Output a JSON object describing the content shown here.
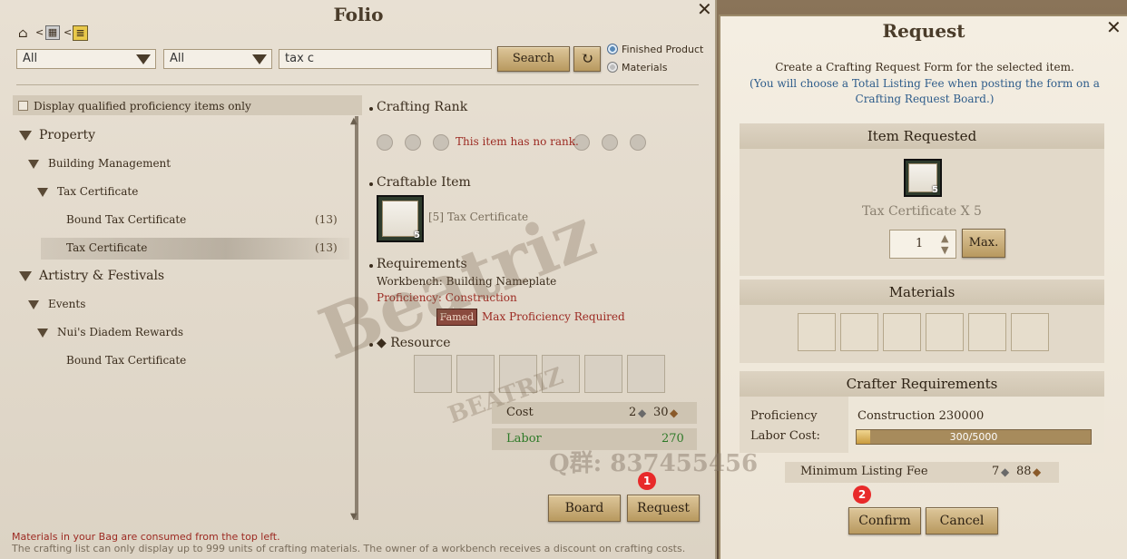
{
  "folio": {
    "title": "Folio",
    "breadcrumb_sep": "<",
    "filter1": "All",
    "filter2": "All",
    "search_value": "tax c",
    "search_label": "Search",
    "radio_finished": "Finished Product",
    "radio_materials": "Materials",
    "checkbox_label": "Display qualified proficiency items only",
    "tree": {
      "property": "Property",
      "building_management": "Building Management",
      "tax_certificate_group": "Tax Certificate",
      "bound_tax_certificate": "Bound Tax Certificate",
      "bound_count": "(13)",
      "tax_certificate": "Tax Certificate",
      "tax_count": "(13)",
      "artistry": "Artistry & Festivals",
      "events": "Events",
      "nuis": "Nui's Diadem Rewards",
      "bound_tax_certificate_2": "Bound Tax Certificate"
    },
    "crafting_rank_label": "Crafting Rank",
    "no_rank": "This item has no rank.",
    "craftable_label": "Craftable Item",
    "craftable_item": "[5] Tax Certificate",
    "item_badge": "5",
    "requirements_label": "Requirements",
    "workbench": "Workbench: Building Nameplate",
    "proficiency": "Proficiency: Construction",
    "famed": "Famed",
    "max_prof": "Max Proficiency Required",
    "resource_label": "◆ Resource",
    "cost_label": "Cost",
    "cost_gold": "2",
    "cost_silver": "30",
    "labor_label": "Labor",
    "labor_value": "270",
    "board_label": "Board",
    "request_label": "Request",
    "footer1": "Materials in your Bag are consumed from the top left.",
    "footer2": "The crafting list can only display up to 999 units of crafting materials. The owner of a workbench receives a discount on crafting costs."
  },
  "request": {
    "title": "Request",
    "desc1": "Create a Crafting Request Form for the selected item.",
    "desc2": "(You will choose a Total Listing Fee when posting the form on a Crafting Request Board.)",
    "item_requested_label": "Item Requested",
    "item_name": "Tax Certificate X 5",
    "item_badge": "5",
    "quantity": "1",
    "max_label": "Max.",
    "materials_label": "Materials",
    "crafter_req_label": "Crafter Requirements",
    "proficiency_label": "Proficiency",
    "proficiency_value": "Construction 230000",
    "labor_cost_label": "Labor Cost:",
    "labor_progress_text": "300/5000",
    "labor_progress": 0.06,
    "min_fee_label": "Minimum Listing Fee",
    "fee_gold": "7",
    "fee_silver": "88",
    "confirm_label": "Confirm",
    "cancel_label": "Cancel"
  },
  "markers": {
    "one": "1",
    "two": "2"
  },
  "watermark": {
    "text1": "Beatriz",
    "text2": "BEATRIZ",
    "text3": "Q群: 837455456"
  }
}
